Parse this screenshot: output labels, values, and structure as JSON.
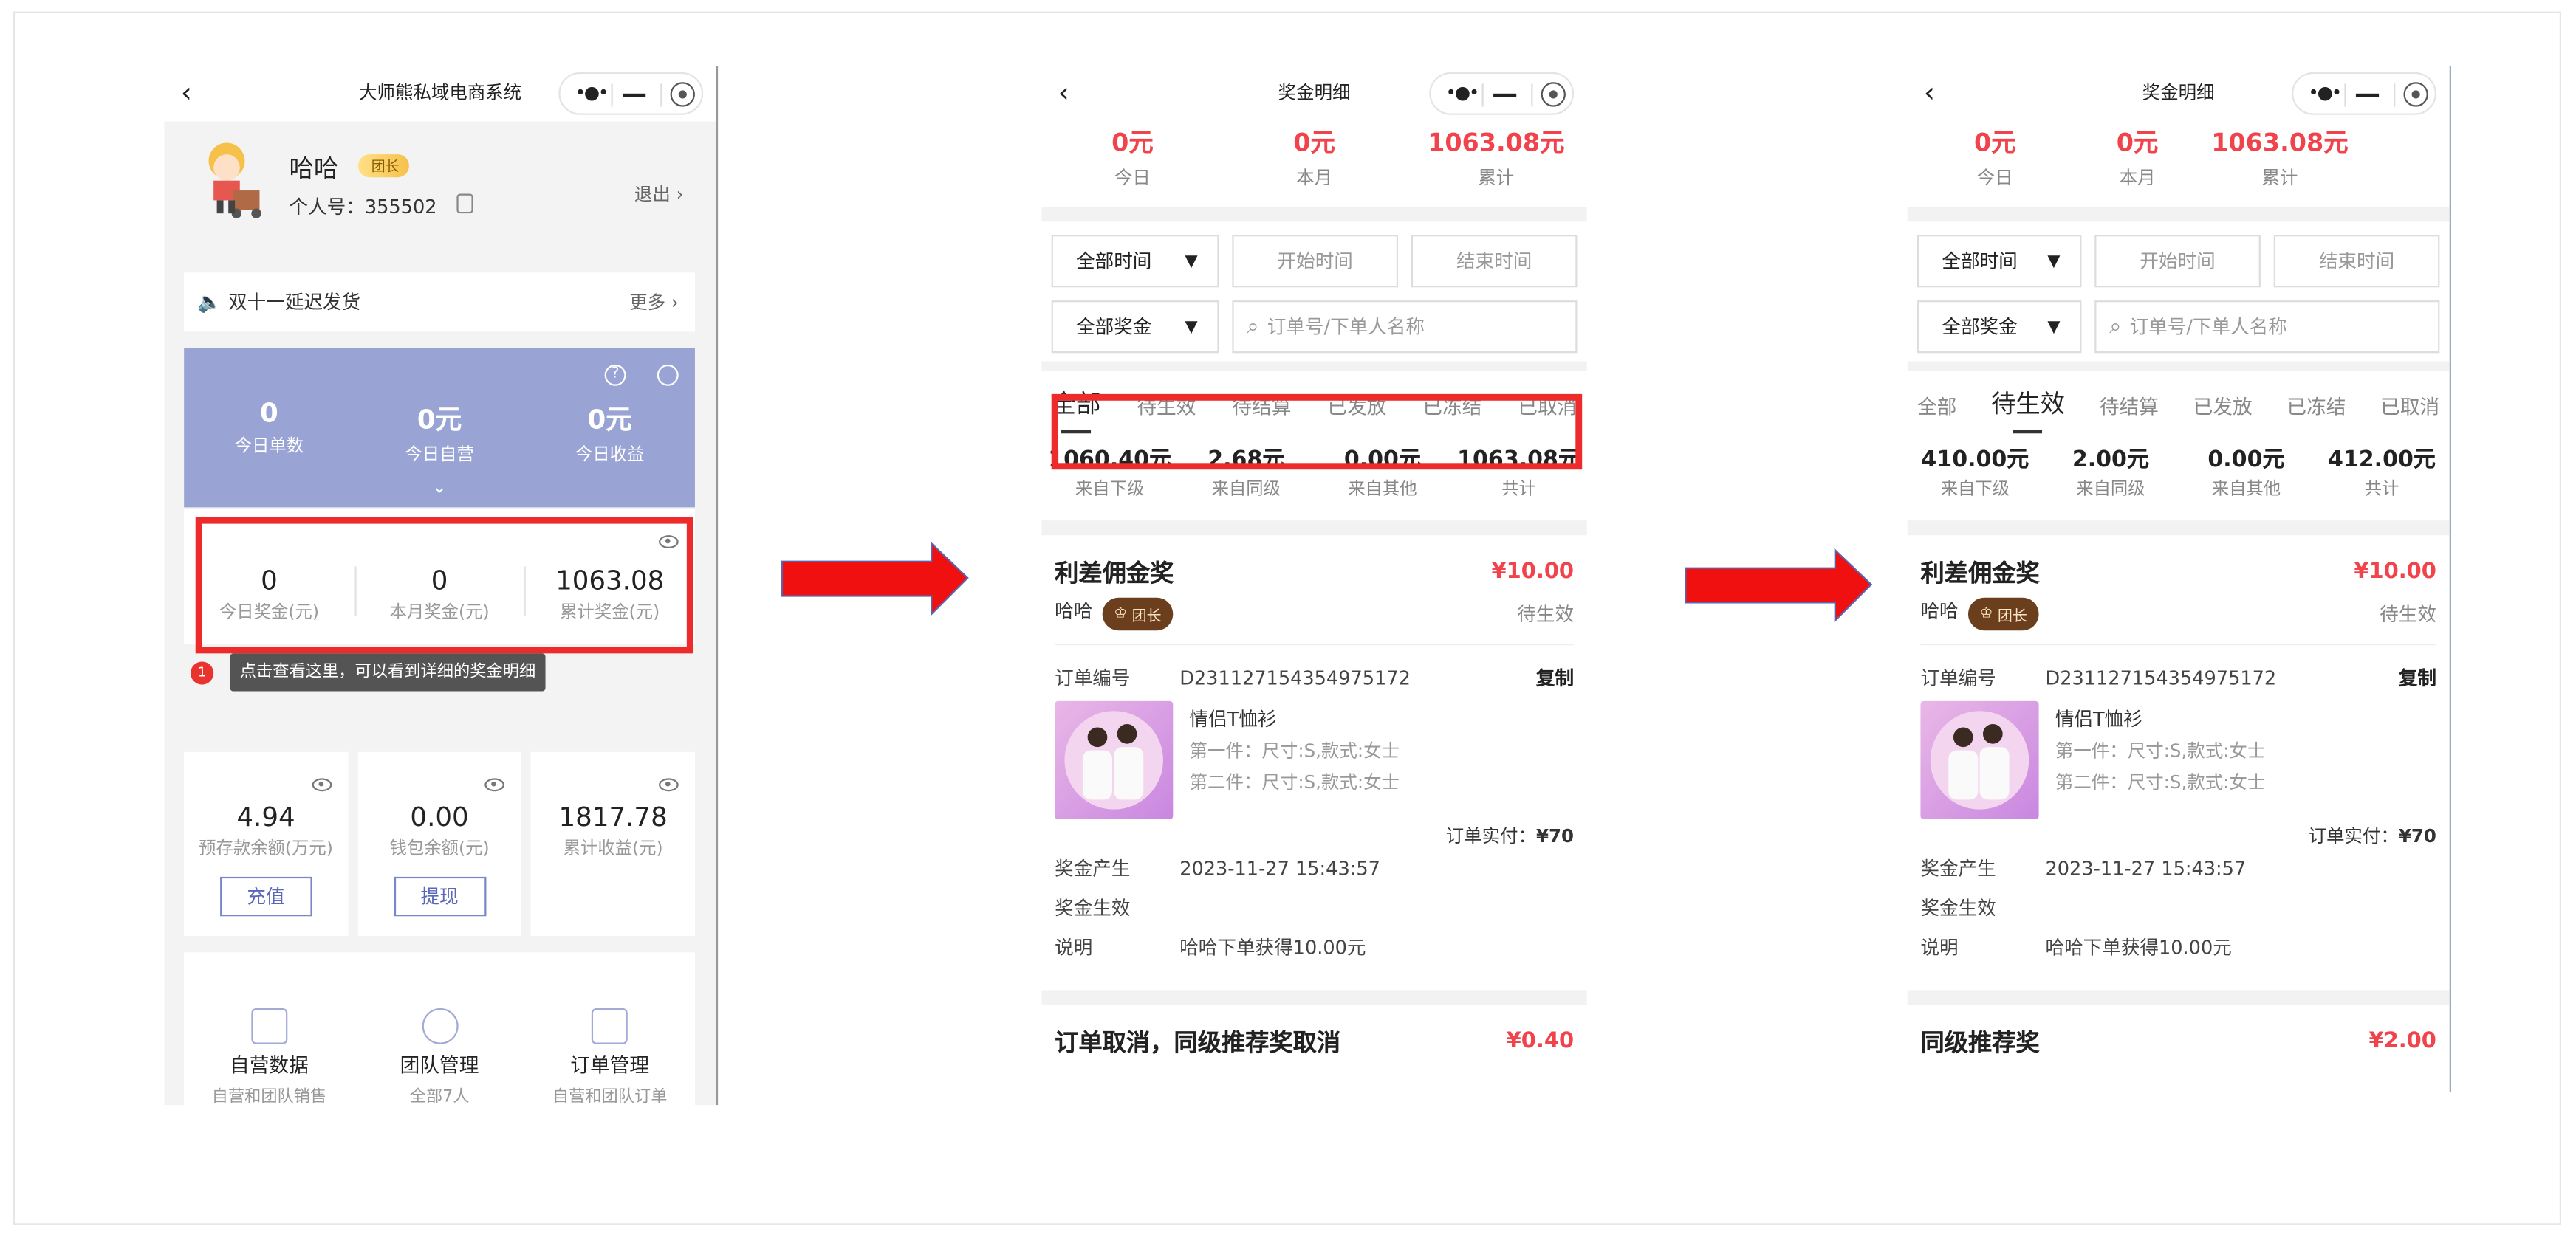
{
  "left": {
    "title": "大师熊私域电商系统",
    "user": {
      "name": "哈哈",
      "badge": "团长",
      "id_label": "个人号：355502",
      "logout": "退出"
    },
    "notice": {
      "text": "双十一延迟发货",
      "more": "更多"
    },
    "today": [
      {
        "value": "0",
        "label": "今日单数"
      },
      {
        "value": "0元",
        "label": "今日自营"
      },
      {
        "value": "0元",
        "label": "今日收益"
      }
    ],
    "bonus": [
      {
        "value": "0",
        "label": "今日奖金(元)"
      },
      {
        "value": "0",
        "label": "本月奖金(元)"
      },
      {
        "value": "1063.08",
        "label": "累计奖金(元)"
      }
    ],
    "tip": {
      "number": "1",
      "text": "点击查看这里，可以看到详细的奖金明细"
    },
    "wallet": [
      {
        "value": "4.94",
        "label": "预存款余额(万元)",
        "button": "充值"
      },
      {
        "value": "0.00",
        "label": "钱包余额(元)",
        "button": "提现"
      },
      {
        "value": "1817.78",
        "label": "累计收益(元)",
        "button": ""
      }
    ],
    "grid": [
      {
        "title": "自营数据",
        "sub": "自营和团队销售"
      },
      {
        "title": "团队管理",
        "sub": "全部7人"
      },
      {
        "title": "订单管理",
        "sub": "自营和团队订单"
      }
    ]
  },
  "mid": {
    "title": "奖金明细",
    "summary": [
      {
        "value": "0元",
        "label": "今日"
      },
      {
        "value": "0元",
        "label": "本月"
      },
      {
        "value": "1063.08元",
        "label": "累计"
      }
    ],
    "filters": {
      "time": "全部时间",
      "start": "开始时间",
      "end": "结束时间",
      "bonus": "全部奖金",
      "search": "订单号/下单人名称"
    },
    "tabs": [
      "全部",
      "待生效",
      "待结算",
      "已发放",
      "已冻结",
      "已取消"
    ],
    "totals": [
      {
        "value": "1060.40元",
        "label": "来自下级"
      },
      {
        "value": "2.68元",
        "label": "来自同级"
      },
      {
        "value": "0.00元",
        "label": "来自其他"
      },
      {
        "value": "1063.08元",
        "label": "共计"
      }
    ],
    "card": {
      "title": "利差佣金奖",
      "amount": "¥10.00",
      "user": "哈哈",
      "tag": "团长",
      "status": "待生效",
      "order_label": "订单编号",
      "order_no": "D231127154354975172",
      "copy": "复制",
      "product": "情侣T恤衫",
      "spec1": "第一件：尺寸:S,款式:女士",
      "spec2": "第二件：尺寸:S,款式:女士",
      "paid_label": "订单实付：",
      "paid": "¥70",
      "gen_label": "奖金产生",
      "gen_time": "2023-11-27 15:43:57",
      "eff_label": "奖金生效",
      "note_label": "说明",
      "note": "哈哈下单获得10.00元"
    },
    "next_title": "订单取消，同级推荐奖取消",
    "next_amount": "¥0.40"
  },
  "right": {
    "title": "奖金明细",
    "summary": [
      {
        "value": "0元",
        "label": "今日"
      },
      {
        "value": "0元",
        "label": "本月"
      },
      {
        "value": "1063.08元",
        "label": "累计"
      }
    ],
    "filters": {
      "time": "全部时间",
      "start": "开始时间",
      "end": "结束时间",
      "bonus": "全部奖金",
      "search": "订单号/下单人名称"
    },
    "tabs": [
      "全部",
      "待生效",
      "待结算",
      "已发放",
      "已冻结",
      "已取消"
    ],
    "totals": [
      {
        "value": "410.00元",
        "label": "来自下级"
      },
      {
        "value": "2.00元",
        "label": "来自同级"
      },
      {
        "value": "0.00元",
        "label": "来自其他"
      },
      {
        "value": "412.00元",
        "label": "共计"
      }
    ],
    "card": {
      "title": "利差佣金奖",
      "amount": "¥10.00",
      "user": "哈哈",
      "tag": "团长",
      "status": "待生效",
      "order_label": "订单编号",
      "order_no": "D231127154354975172",
      "copy": "复制",
      "product": "情侣T恤衫",
      "spec1": "第一件：尺寸:S,款式:女士",
      "spec2": "第二件：尺寸:S,款式:女士",
      "paid_label": "订单实付：",
      "paid": "¥70",
      "gen_label": "奖金产生",
      "gen_time": "2023-11-27 15:43:57",
      "eff_label": "奖金生效",
      "note_label": "说明",
      "note": "哈哈下单获得10.00元"
    },
    "next_title": "同级推荐奖",
    "next_amount": "¥2.00"
  },
  "colors": {
    "accent_red": "#f0434b",
    "highlight_box": "#ee2b2b",
    "purple_panel": "#9aa4d4",
    "arrow": "#f01010"
  },
  "icons": [
    "back-icon",
    "more-dots-icon",
    "minimize-icon",
    "record-icon",
    "speaker-icon",
    "chevron-right-icon",
    "eye-icon",
    "help-icon",
    "settings-icon",
    "copy-icon",
    "search-icon",
    "crown-icon",
    "arrow-right-icon"
  ]
}
